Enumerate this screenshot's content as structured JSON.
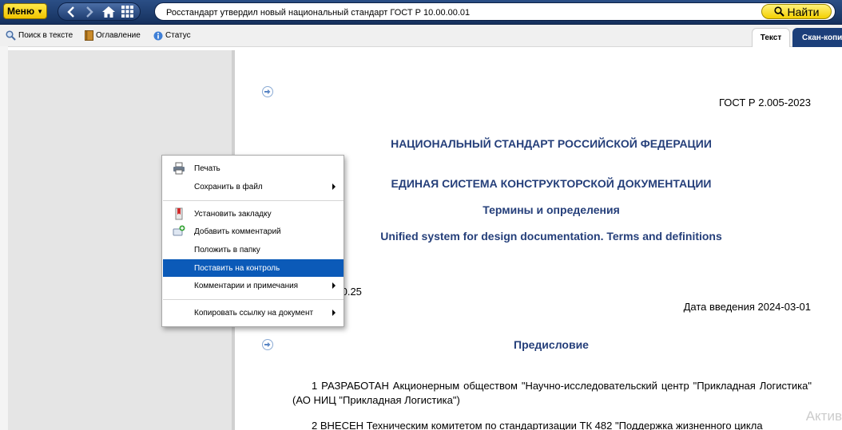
{
  "topbar": {
    "menu_label": "Меню",
    "search_value": "Росстандарт утвердил новый национальный стандарт ГОСТ Р 10.00.00.01",
    "find_label": "Найти",
    "nav_icons": [
      "back-icon",
      "forward-icon",
      "home-icon",
      "grid-icon"
    ]
  },
  "toolbar": {
    "search_in_text": "Поиск в тексте",
    "contents": "Оглавление",
    "status": "Статус",
    "tabs": [
      "Текст",
      "Скан-копия"
    ]
  },
  "document": {
    "number": "ГОСТ Р 2.005-2023",
    "title_1": "НАЦИОНАЛЬНЫЙ СТАНДАРТ РОССИЙСКОЙ ФЕДЕРАЦИИ",
    "title_2": "ЕДИНАЯ СИСТЕМА КОНСТРУКТОРСКОЙ ДОКУМЕНТАЦИИ",
    "title_3": "Термины и определения",
    "title_en": "Unified system for design documentation. Terms and definitions",
    "partial_code": ".0.25",
    "intro_date": "Дата введения 2024-03-01",
    "preface_heading": "Предисловие",
    "para_1": "1 РАЗРАБОТАН Акционерным обществом \"Научно-исследовательский центр \"Прикладная Логистика\" (АО НИЦ \"Прикладная Логистика\")",
    "para_2": "2 ВНЕСЕН Техническим комитетом по стандартизации ТК 482 \"Поддержка жизненного цикла"
  },
  "context_menu": {
    "items": [
      {
        "label": "Печать",
        "icon": "printer-icon",
        "submenu": false
      },
      {
        "label": "Сохранить в файл",
        "icon": "",
        "submenu": true
      },
      {
        "label": "Установить закладку",
        "icon": "bookmark-icon",
        "submenu": false
      },
      {
        "label": "Добавить комментарий",
        "icon": "add-comment-icon",
        "submenu": false
      },
      {
        "label": "Положить в папку",
        "icon": "",
        "submenu": false
      },
      {
        "label": "Поставить на контроль",
        "icon": "",
        "submenu": false,
        "highlighted": true
      },
      {
        "label": "Комментарии и примечания",
        "icon": "",
        "submenu": true
      },
      {
        "label": "Копировать ссылку на документ",
        "icon": "",
        "submenu": true
      }
    ]
  },
  "watermark": "Актив",
  "colors": {
    "topbar": "#1e3d70",
    "accent_yellow": "#f4d000",
    "heading_blue": "#253f7a",
    "menu_highlight": "#0b5ab8"
  }
}
